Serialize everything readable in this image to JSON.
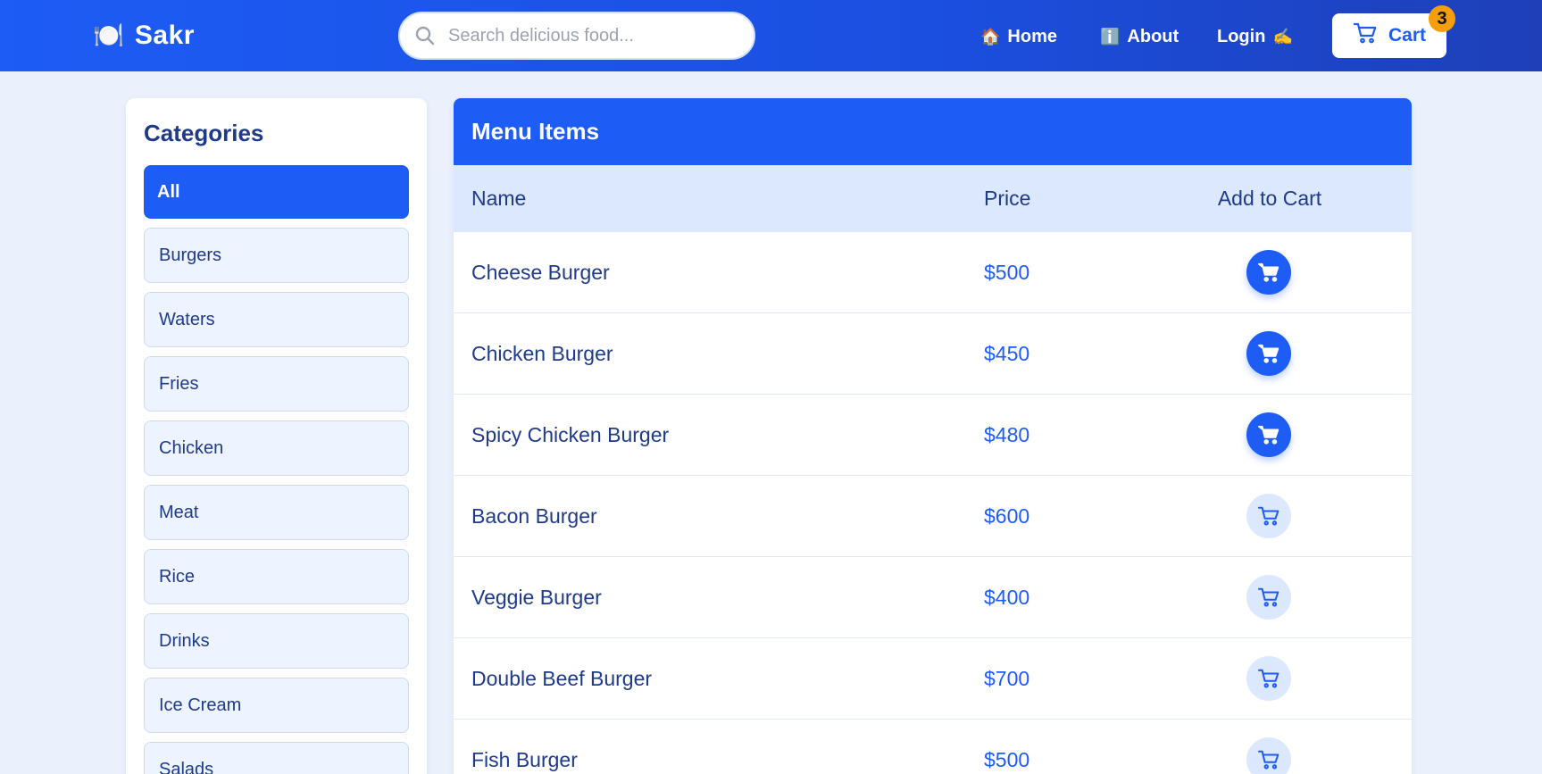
{
  "brand": {
    "icon": "plate-icon",
    "name": "Sakr"
  },
  "search": {
    "placeholder": "Search delicious food...",
    "value": ""
  },
  "nav": {
    "home": {
      "emoji": "🏠",
      "label": "Home"
    },
    "about": {
      "emoji": "ℹ️",
      "label": "About"
    },
    "login": {
      "label": "Login",
      "emoji": "✍️"
    }
  },
  "cart": {
    "label": "Cart",
    "count": "3"
  },
  "sidebar": {
    "title": "Categories",
    "items": [
      {
        "label": "All",
        "active": true
      },
      {
        "label": "Burgers"
      },
      {
        "label": "Waters"
      },
      {
        "label": "Fries"
      },
      {
        "label": "Chicken"
      },
      {
        "label": "Meat"
      },
      {
        "label": "Rice"
      },
      {
        "label": "Drinks"
      },
      {
        "label": "Ice Cream"
      },
      {
        "label": "Salads"
      }
    ]
  },
  "menu": {
    "title": "Menu Items",
    "columns": {
      "name": "Name",
      "price": "Price",
      "cart": "Add to Cart"
    },
    "rows": [
      {
        "name": "Cheese Burger",
        "price": "$500",
        "in_cart": true
      },
      {
        "name": "Chicken Burger",
        "price": "$450",
        "in_cart": true
      },
      {
        "name": "Spicy Chicken Burger",
        "price": "$480",
        "in_cart": true
      },
      {
        "name": "Bacon Burger",
        "price": "$600",
        "in_cart": false
      },
      {
        "name": "Veggie Burger",
        "price": "$400",
        "in_cart": false
      },
      {
        "name": "Double Beef Burger",
        "price": "$700",
        "in_cart": false
      },
      {
        "name": "Fish Burger",
        "price": "$500",
        "in_cart": false
      }
    ]
  },
  "colors": {
    "primary": "#1d5cf5",
    "badge": "#f59e0b",
    "text": "#1e3a8a",
    "background": "#eaf1fc"
  }
}
